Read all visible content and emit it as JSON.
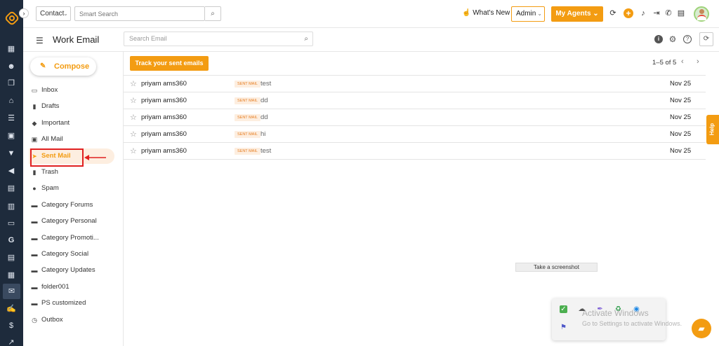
{
  "topbar": {
    "context_select": "Contact",
    "search_placeholder": "Smart Search",
    "whats_new": "What's New",
    "admin_select": "Admin",
    "agents_button": "My Agents"
  },
  "subhead": {
    "title": "Work Email",
    "search_placeholder": "Search Email"
  },
  "sidebar": {
    "compose": "Compose",
    "folders": [
      {
        "label": "Inbox",
        "icon": "inbox-icon",
        "glyph": "▭"
      },
      {
        "label": "Drafts",
        "icon": "draft-icon",
        "glyph": "▮"
      },
      {
        "label": "Important",
        "icon": "tag-icon",
        "glyph": "◆"
      },
      {
        "label": "All Mail",
        "icon": "all-mail-icon",
        "glyph": "▣"
      },
      {
        "label": "Sent Mail",
        "icon": "send-icon",
        "glyph": "➤"
      },
      {
        "label": "Trash",
        "icon": "trash-icon",
        "glyph": "▮"
      },
      {
        "label": "Spam",
        "icon": "spam-icon",
        "glyph": "●"
      },
      {
        "label": "Category Forums",
        "icon": "folder-icon",
        "glyph": "▬"
      },
      {
        "label": "Category Personal",
        "icon": "folder-icon",
        "glyph": "▬"
      },
      {
        "label": "Category Promoti...",
        "icon": "folder-icon",
        "glyph": "▬"
      },
      {
        "label": "Category Social",
        "icon": "folder-icon",
        "glyph": "▬"
      },
      {
        "label": "Category Updates",
        "icon": "folder-icon",
        "glyph": "▬"
      },
      {
        "label": "folder001",
        "icon": "folder-icon",
        "glyph": "▬"
      },
      {
        "label": "PS customized",
        "icon": "folder-icon",
        "glyph": "▬"
      },
      {
        "label": "Outbox",
        "icon": "clock-icon",
        "glyph": "◷"
      }
    ],
    "active_index": 4
  },
  "main": {
    "track_button": "Track your sent emails",
    "pager": "1–5 of 5",
    "tag_label": "SENT MAIL",
    "rows": [
      {
        "from": "priyam ams360",
        "subject": "test",
        "date": "Nov 25"
      },
      {
        "from": "priyam ams360",
        "subject": "dd",
        "date": "Nov 25"
      },
      {
        "from": "priyam ams360",
        "subject": "dd",
        "date": "Nov 25"
      },
      {
        "from": "priyam ams360",
        "subject": "hi",
        "date": "Nov 25"
      },
      {
        "from": "priyam ams360",
        "subject": "test",
        "date": "Nov 25"
      }
    ]
  },
  "help_tab": "Help",
  "screenshot_tooltip": "Take a screenshot",
  "watermark": {
    "line1": "Activate Windows",
    "line2": "Go to Settings to activate Windows."
  },
  "colors": {
    "accent": "#f39c12",
    "rail": "#1e2b3c",
    "highlight": "#e02020"
  }
}
